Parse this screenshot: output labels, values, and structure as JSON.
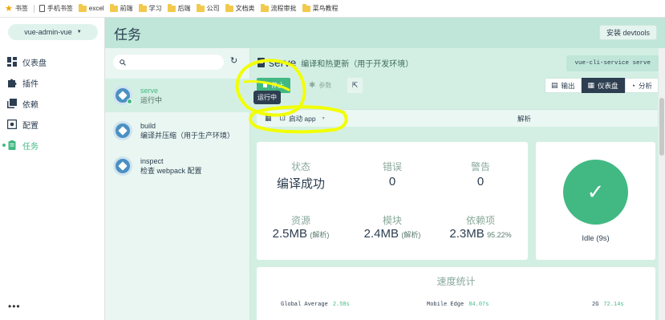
{
  "bookmarks": {
    "items": [
      {
        "label": "书签",
        "icon": "star-icon"
      },
      {
        "label": "手机书签",
        "icon": "page-icon"
      },
      {
        "label": "excel",
        "icon": "folder-icon"
      },
      {
        "label": "前端",
        "icon": "folder-icon"
      },
      {
        "label": "学习",
        "icon": "folder-icon"
      },
      {
        "label": "后端",
        "icon": "folder-icon"
      },
      {
        "label": "公司",
        "icon": "folder-icon"
      },
      {
        "label": "文档类",
        "icon": "folder-icon"
      },
      {
        "label": "流程审批",
        "icon": "folder-icon"
      },
      {
        "label": "菜鸟教程",
        "icon": "folder-icon"
      }
    ]
  },
  "sidebar": {
    "project": "vue-admin-vue",
    "items": [
      {
        "label": "仪表盘",
        "icon": "dashboard-icon"
      },
      {
        "label": "插件",
        "icon": "puzzle-icon"
      },
      {
        "label": "依赖",
        "icon": "library-icon"
      },
      {
        "label": "配置",
        "icon": "settings-box-icon"
      },
      {
        "label": "任务",
        "icon": "clipboard-icon",
        "active": true
      }
    ],
    "more": "•••"
  },
  "header": {
    "title": "任务",
    "devtools_label": "安装 devtools"
  },
  "tasks": {
    "search_placeholder": "",
    "items": [
      {
        "name": "serve",
        "desc": "运行中",
        "selected": true
      },
      {
        "name": "build",
        "desc": "编译并压缩（用于生产环境）"
      },
      {
        "name": "inspect",
        "desc": "检查 webpack 配置"
      }
    ]
  },
  "main": {
    "task_name": "serve",
    "task_desc": "编译和热更新（用于开发环境）",
    "command": "vue-cli-service serve",
    "stop_label": "停止",
    "params_label": "参数",
    "tooltip": "运行中",
    "tabs": [
      {
        "label": "输出",
        "icon": "terminal-icon"
      },
      {
        "label": "仪表盘",
        "icon": "dashboard-icon",
        "active": true
      },
      {
        "label": "分析",
        "icon": "pie-icon"
      }
    ],
    "launch_label": "启动 app",
    "analyze_label": "解析"
  },
  "stats": {
    "status": {
      "label": "状态",
      "value": "编译成功"
    },
    "errors": {
      "label": "错误",
      "value": "0"
    },
    "warnings": {
      "label": "警告",
      "value": "0"
    },
    "assets": {
      "label": "资源",
      "value": "2.5MB",
      "sub": "(解析)"
    },
    "modules": {
      "label": "模块",
      "value": "2.4MB",
      "sub": "(解析)"
    },
    "deps": {
      "label": "依赖项",
      "value": "2.3MB",
      "sub": "95.22%"
    }
  },
  "status_card": {
    "idle": "Idle (9s)"
  },
  "speed": {
    "title": "速度统计",
    "rows": [
      {
        "label": "Global Average",
        "value": "2.58s"
      },
      {
        "label": "Mobile Edge",
        "value": "84.07s"
      },
      {
        "label": "2G",
        "value": "72.14s"
      }
    ]
  },
  "colors": {
    "accent": "#42b983",
    "dark": "#2c3e50",
    "annotation": "#f2ff00"
  }
}
